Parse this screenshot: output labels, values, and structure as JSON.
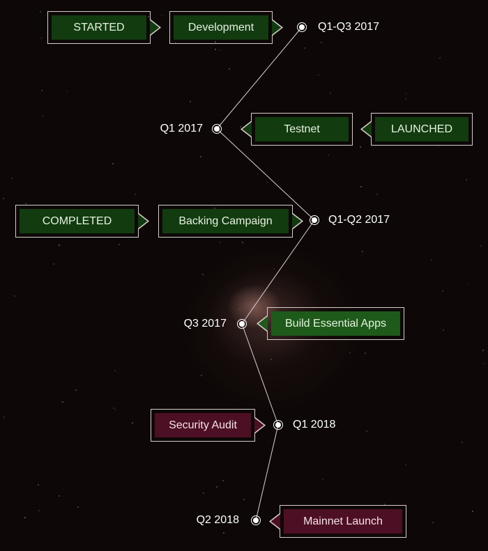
{
  "colors": {
    "background": "#0d0807",
    "green_box": "#123b10",
    "red_box": "#4d0f24",
    "border": "#d8cccc",
    "line": "#d9d4d4"
  },
  "milestones": [
    {
      "date": "Q1-Q3 2017",
      "tasks": [
        "Development"
      ],
      "status": "STARTED"
    },
    {
      "date": "Q1 2017",
      "tasks": [
        "Testnet"
      ],
      "status": "LAUNCHED"
    },
    {
      "date": "Q1-Q2 2017",
      "tasks": [
        "Backing Campaign"
      ],
      "status": "COMPLETED"
    },
    {
      "date": "Q3 2017",
      "tasks": [
        "Build Essential Apps"
      ],
      "status": ""
    },
    {
      "date": "Q1 2018",
      "tasks": [
        "Security Audit"
      ],
      "status": ""
    },
    {
      "date": "Q2 2018",
      "tasks": [
        "Mainnet Launch"
      ],
      "status": ""
    }
  ]
}
